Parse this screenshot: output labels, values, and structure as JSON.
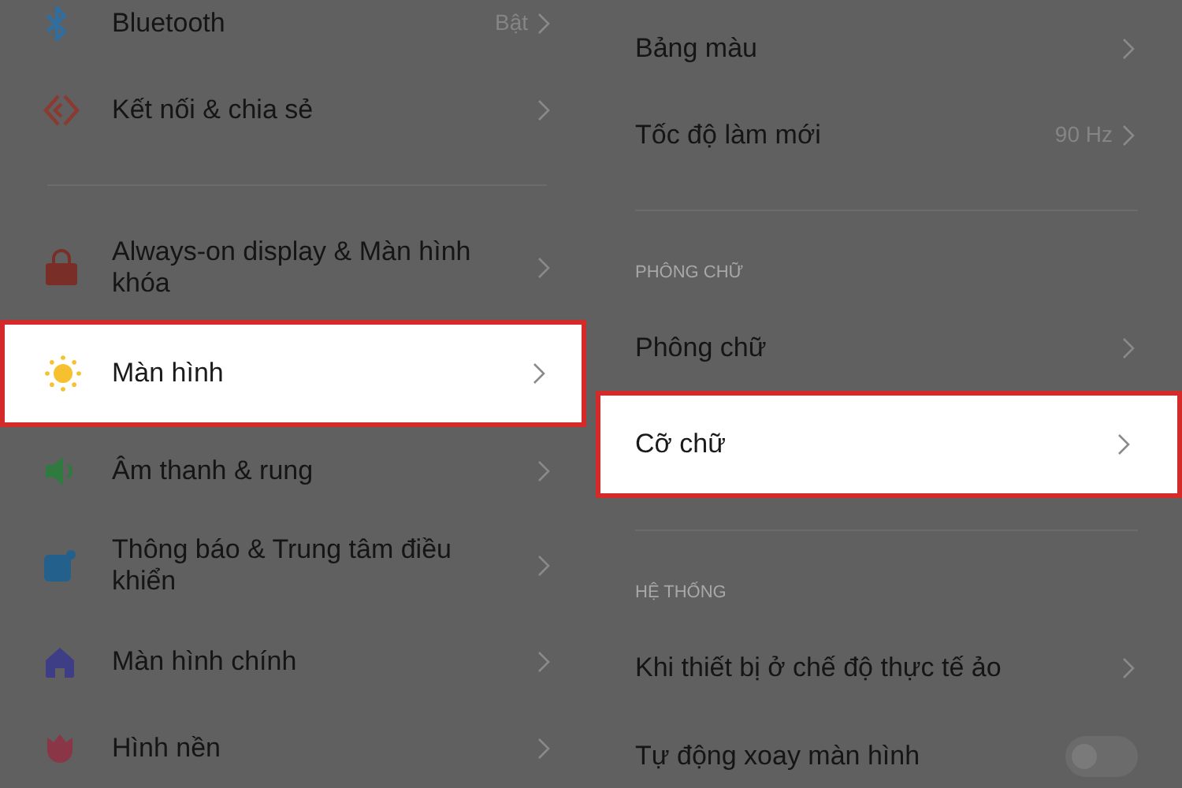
{
  "panels": [
    {
      "items": [
        {
          "kind": "row",
          "label": "Bluetooth",
          "value": "Bật",
          "highlighted": false
        },
        {
          "kind": "row",
          "label": "Kết nối & chia sẻ",
          "highlighted": false
        },
        {
          "kind": "divider"
        },
        {
          "kind": "row",
          "label": "Always-on display & Màn hình khóa",
          "highlighted": false
        },
        {
          "kind": "row",
          "label": "Màn hình",
          "highlighted": true
        },
        {
          "kind": "row",
          "label": "Âm thanh & rung",
          "highlighted": false
        },
        {
          "kind": "row",
          "label": "Thông báo & Trung tâm điều khiển",
          "highlighted": false
        },
        {
          "kind": "row",
          "label": "Màn hình chính",
          "highlighted": false
        },
        {
          "kind": "row",
          "label": "Hình nền",
          "highlighted": false
        }
      ]
    },
    {
      "items": [
        {
          "kind": "row",
          "label": "Bảng màu",
          "highlighted": false
        },
        {
          "kind": "row",
          "label": "Tốc độ làm mới",
          "value": "90 Hz",
          "highlighted": false
        },
        {
          "kind": "divider"
        },
        {
          "kind": "header",
          "label": "PHÔNG CHỮ"
        },
        {
          "kind": "row",
          "label": "Phông chữ",
          "highlighted": false
        },
        {
          "kind": "row",
          "label": "Cỡ chữ",
          "highlighted": true
        },
        {
          "kind": "divider"
        },
        {
          "kind": "header",
          "label": "HỆ THỐNG"
        },
        {
          "kind": "row",
          "label": "Khi thiết bị ở chế độ thực tế ảo",
          "highlighted": false
        },
        {
          "kind": "toggle",
          "label": "Tự động xoay màn hình",
          "on": false
        }
      ]
    }
  ]
}
